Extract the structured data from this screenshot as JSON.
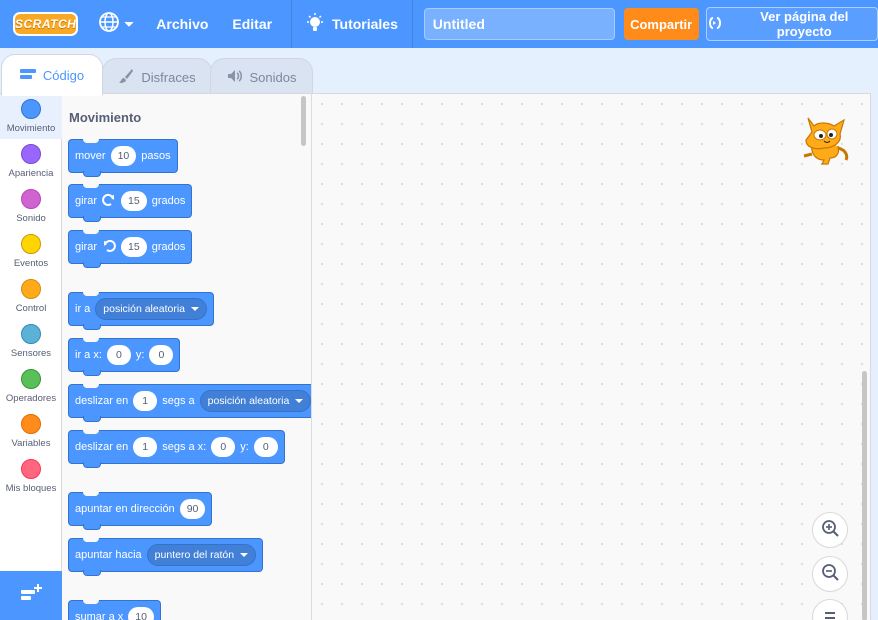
{
  "menubar": {
    "logo": "SCRATCH",
    "archivo": "Archivo",
    "editar": "Editar",
    "tutoriales": "Tutoriales",
    "project_title": "Untitled",
    "share": "Compartir",
    "see_project": "Ver página del proyecto"
  },
  "tabs": {
    "code": "Código",
    "costumes": "Disfraces",
    "sounds": "Sonidos"
  },
  "categories": [
    {
      "label": "Movimiento",
      "color": "#4c97ff"
    },
    {
      "label": "Apariencia",
      "color": "#9966ff"
    },
    {
      "label": "Sonido",
      "color": "#cf63cf"
    },
    {
      "label": "Eventos",
      "color": "#ffd500"
    },
    {
      "label": "Control",
      "color": "#ffab19"
    },
    {
      "label": "Sensores",
      "color": "#5cb1d6"
    },
    {
      "label": "Operadores",
      "color": "#59c059"
    },
    {
      "label": "Variables",
      "color": "#ff8c1a"
    },
    {
      "label": "Mis bloques",
      "color": "#ff6680"
    }
  ],
  "flyout": {
    "title": "Movimiento",
    "blocks": {
      "move": {
        "a": "mover",
        "v": "10",
        "b": "pasos"
      },
      "turn_right": {
        "a": "girar",
        "v": "15",
        "b": "grados"
      },
      "turn_left": {
        "a": "girar",
        "v": "15",
        "b": "grados"
      },
      "goto": {
        "a": "ir a",
        "d": "posición aleatoria"
      },
      "goto_xy": {
        "a": "ir a x:",
        "v1": "0",
        "b": "y:",
        "v2": "0"
      },
      "glide_to": {
        "a": "deslizar en",
        "v": "1",
        "b": "segs a",
        "d": "posición aleatoria"
      },
      "glide_xy": {
        "a": "deslizar en",
        "v1": "1",
        "b": "segs a x:",
        "v2": "0",
        "c": "y:",
        "v3": "0"
      },
      "point_dir": {
        "a": "apuntar en dirección",
        "v": "90"
      },
      "point_towards": {
        "a": "apuntar hacia",
        "d": "puntero del ratón"
      },
      "change_x": {
        "a": "sumar a x",
        "v": "10"
      }
    }
  }
}
